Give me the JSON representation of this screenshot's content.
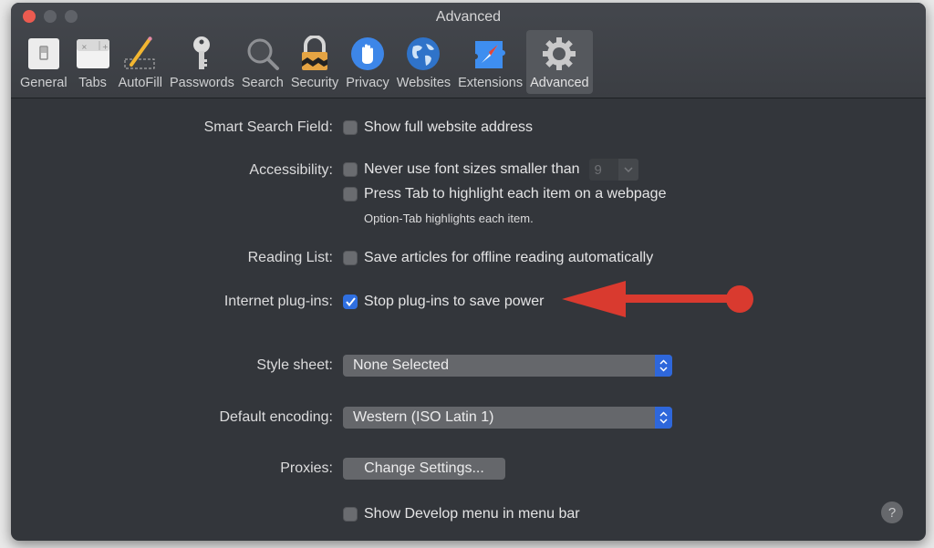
{
  "window": {
    "title": "Advanced",
    "traffic_lights": [
      "close",
      "minimize",
      "zoom"
    ]
  },
  "toolbar": {
    "items": [
      {
        "label": "General",
        "icon": "general-switch-icon"
      },
      {
        "label": "Tabs",
        "icon": "tabs-icon"
      },
      {
        "label": "AutoFill",
        "icon": "pencil-icon"
      },
      {
        "label": "Passwords",
        "icon": "key-icon"
      },
      {
        "label": "Search",
        "icon": "magnifier-icon"
      },
      {
        "label": "Security",
        "icon": "padlock-icon"
      },
      {
        "label": "Privacy",
        "icon": "hand-icon"
      },
      {
        "label": "Websites",
        "icon": "globe-icon"
      },
      {
        "label": "Extensions",
        "icon": "compass-puzzle-icon"
      },
      {
        "label": "Advanced",
        "icon": "gear-icon",
        "active": true
      }
    ]
  },
  "settings": {
    "smart_search": {
      "label": "Smart Search Field:",
      "option": "Show full website address",
      "checked": false
    },
    "accessibility": {
      "label": "Accessibility:",
      "font_option": "Never use font sizes smaller than",
      "font_checked": false,
      "font_size_value": "9",
      "tab_option": "Press Tab to highlight each item on a webpage",
      "tab_checked": false,
      "hint": "Option-Tab highlights each item."
    },
    "reading_list": {
      "label": "Reading List:",
      "option": "Save articles for offline reading automatically",
      "checked": false
    },
    "plugins": {
      "label": "Internet plug-ins:",
      "option": "Stop plug-ins to save power",
      "checked": true
    },
    "style_sheet": {
      "label": "Style sheet:",
      "value": "None Selected"
    },
    "encoding": {
      "label": "Default encoding:",
      "value": "Western (ISO Latin 1)"
    },
    "proxies": {
      "label": "Proxies:",
      "button": "Change Settings..."
    },
    "develop": {
      "option": "Show Develop menu in menu bar",
      "checked": false
    },
    "help_label": "?"
  },
  "annotation": {
    "type": "red-arrow",
    "color": "#d93a2f",
    "points_to": "Stop plug-ins to save power"
  },
  "colors": {
    "accent": "#2f6fe0",
    "window_bg": "#33363b",
    "close": "#ec5b50"
  }
}
